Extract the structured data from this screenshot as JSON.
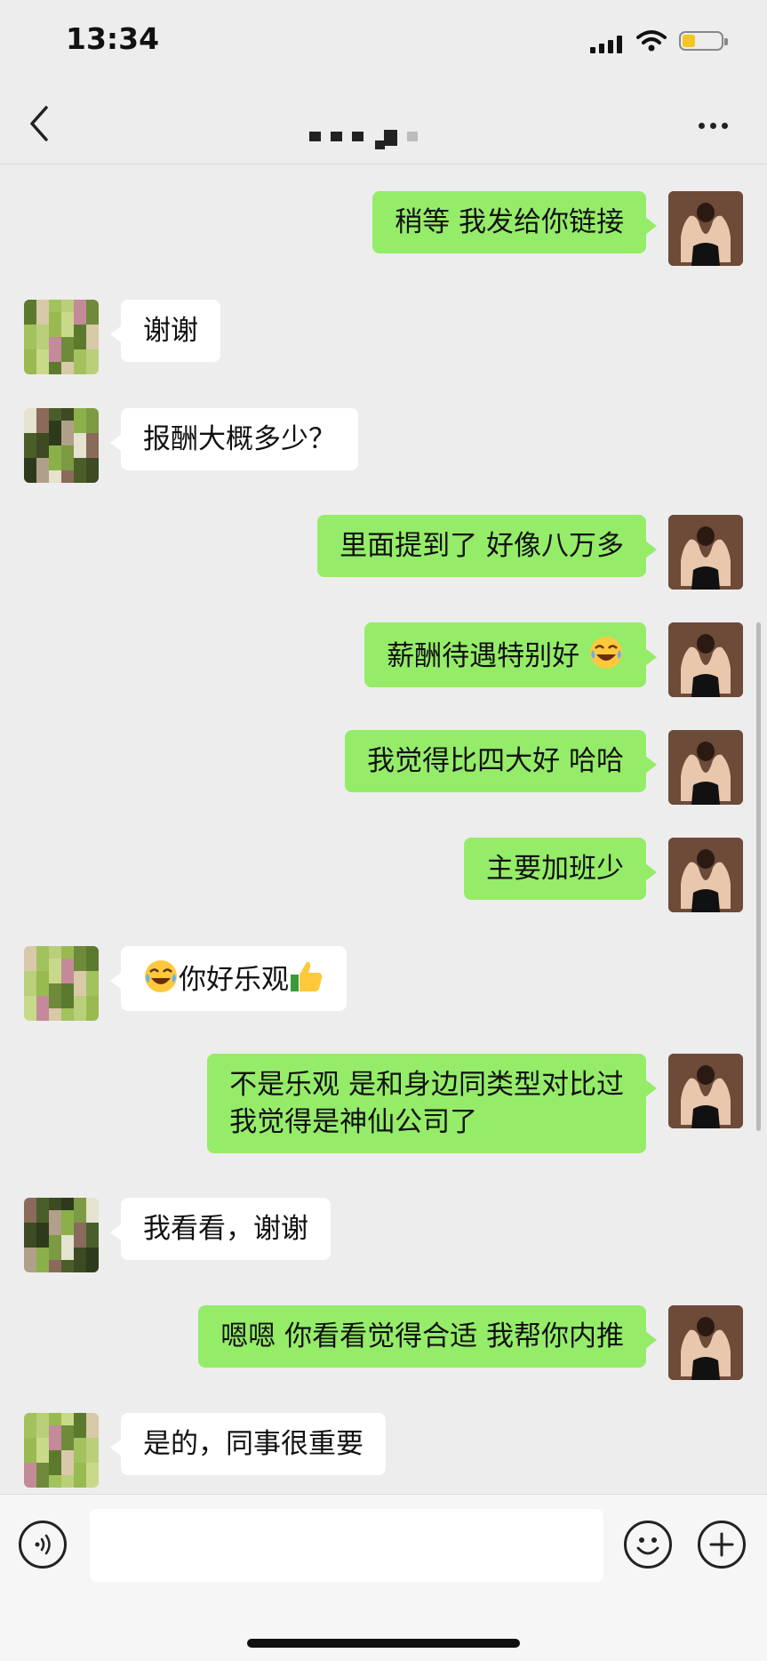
{
  "status_bar": {
    "time": "13:34"
  },
  "nav": {
    "contact_name_redacted": true
  },
  "chat": {
    "messages": [
      {
        "from": "me",
        "text": "稍等 我发给你链接"
      },
      {
        "from": "other",
        "text": "谢谢"
      },
      {
        "from": "other",
        "text": "报酬大概多少？"
      },
      {
        "from": "me",
        "text": "里面提到了 好像八万多"
      },
      {
        "from": "me",
        "text": "薪酬待遇特别好 ",
        "emoji_after": "face-with-tears-of-joy-emoji"
      },
      {
        "from": "me",
        "text": "我觉得比四大好 哈哈"
      },
      {
        "from": "me",
        "text": "主要加班少"
      },
      {
        "from": "other",
        "emoji_before": "face-with-tears-of-joy-emoji",
        "text": "你好乐观",
        "emoji_after": "thumbs-up-emoji"
      },
      {
        "from": "me",
        "text": "不是乐观 是和身边同类型对比过\n我觉得是神仙公司了"
      },
      {
        "from": "other",
        "text": "我看看，谢谢"
      },
      {
        "from": "me",
        "text": "嗯嗯 你看看觉得合适 我帮你内推"
      },
      {
        "from": "other",
        "text": "是的，同事很重要"
      }
    ]
  },
  "input_bar": {
    "value": "",
    "placeholder": ""
  },
  "icons": {
    "back": "chevron-left-icon",
    "more": "more-dots-icon",
    "voice": "voice-icon",
    "emoji": "smiley-icon",
    "plus": "plus-icon"
  },
  "colors": {
    "background": "#ededed",
    "my_bubble": "#95ec69",
    "other_bubble": "#ffffff",
    "battery": "#f3c623"
  }
}
